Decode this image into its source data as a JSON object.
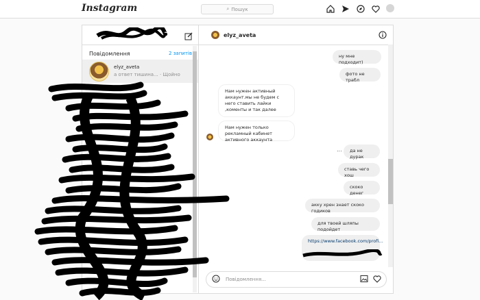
{
  "app": {
    "logo": "Instagram"
  },
  "search": {
    "placeholder": "Пошук"
  },
  "nav": {
    "icons": [
      "home-icon",
      "direct-icon",
      "explore-icon",
      "heart-icon",
      "profile-avatar"
    ]
  },
  "left": {
    "section_title": "Повідомлення",
    "requests": "2 запитів",
    "thread": {
      "username": "elyz_aveta",
      "preview": "а ответ тишина... · Щойно"
    }
  },
  "chat": {
    "username": "elyz_aveta",
    "messages": [
      {
        "dir": "out",
        "text": "ну мне подходит)"
      },
      {
        "dir": "out",
        "text": "фото не трабл"
      },
      {
        "dir": "in",
        "text": "Нам нужен активный аккаунт.мы не будем с него ставить лайки ,коменты и так далее"
      },
      {
        "dir": "in",
        "text": "Нам нужен только рекламный кабинет активного аккаунта"
      },
      {
        "dir": "out",
        "text": "да не дурак"
      },
      {
        "dir": "out",
        "text": "ставь чего хош"
      },
      {
        "dir": "out",
        "text": "скоко денег"
      },
      {
        "dir": "out",
        "text": "акку хрен знает скоко годиков"
      },
      {
        "dir": "out",
        "text": "для твоей шляпы подойдет"
      },
      {
        "dir": "out",
        "text": "https://www.facebook.com/profi..."
      }
    ],
    "dots": "...",
    "composer_placeholder": "Повідомлення..."
  }
}
